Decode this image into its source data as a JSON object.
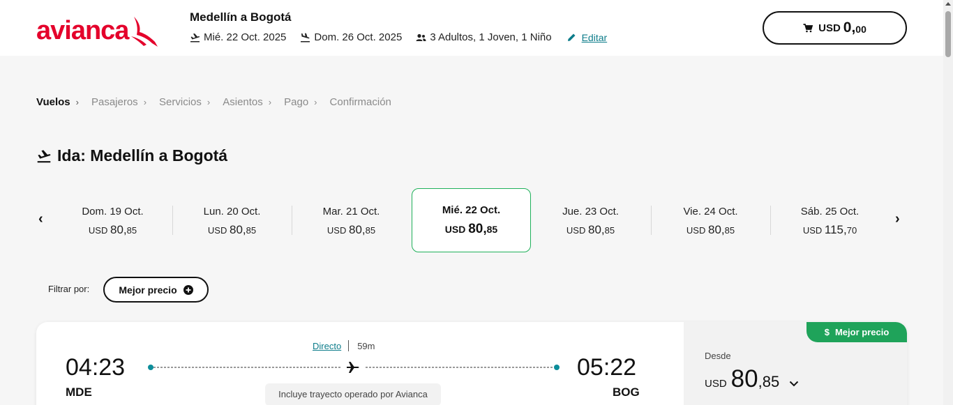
{
  "brand": {
    "name": "avianca",
    "color": "#e4002b"
  },
  "header": {
    "trip_title": "Medellín a Bogotá",
    "departure_date": "Mié. 22 Oct. 2025",
    "return_date": "Dom. 26 Oct. 2025",
    "passengers": "3 Adultos, 1 Joven, 1 Niño",
    "edit_label": "Editar",
    "cart": {
      "currency": "USD",
      "amount_int": "0,",
      "amount_dec": "00"
    }
  },
  "breadcrumb": [
    {
      "label": "Vuelos",
      "active": true
    },
    {
      "label": "Pasajeros",
      "active": false
    },
    {
      "label": "Servicios",
      "active": false
    },
    {
      "label": "Asientos",
      "active": false
    },
    {
      "label": "Pago",
      "active": false
    },
    {
      "label": "Confirmación",
      "active": false
    }
  ],
  "section_title": "Ida: Medellín a Bogotá",
  "dates": [
    {
      "day": "Dom. 19 Oct.",
      "currency": "USD",
      "int": "80,",
      "dec": "85"
    },
    {
      "day": "Lun. 20 Oct.",
      "currency": "USD",
      "int": "80,",
      "dec": "85"
    },
    {
      "day": "Mar. 21 Oct.",
      "currency": "USD",
      "int": "80,",
      "dec": "85"
    },
    {
      "day": "Mié. 22 Oct.",
      "currency": "USD",
      "int": "80,",
      "dec": "85",
      "selected": true
    },
    {
      "day": "Jue. 23 Oct.",
      "currency": "USD",
      "int": "80,",
      "dec": "85"
    },
    {
      "day": "Vie. 24 Oct.",
      "currency": "USD",
      "int": "80,",
      "dec": "85"
    },
    {
      "day": "Sáb. 25 Oct.",
      "currency": "USD",
      "int": "115,",
      "dec": "70"
    }
  ],
  "filter": {
    "label": "Filtrar por:",
    "button": "Mejor precio"
  },
  "flight": {
    "departure_time": "04:23",
    "departure_code": "MDE",
    "arrival_time": "05:22",
    "arrival_code": "BOG",
    "stops": "Directo",
    "duration": "59m",
    "operated_by": "Incluye trayecto operado por Avianca",
    "badge": "Mejor precio",
    "price_from": "Desde",
    "currency": "USD",
    "price_int": "80",
    "price_dec": ",85"
  },
  "colors": {
    "accent_green": "#1fb05a",
    "link_teal": "#0c7c8a"
  }
}
